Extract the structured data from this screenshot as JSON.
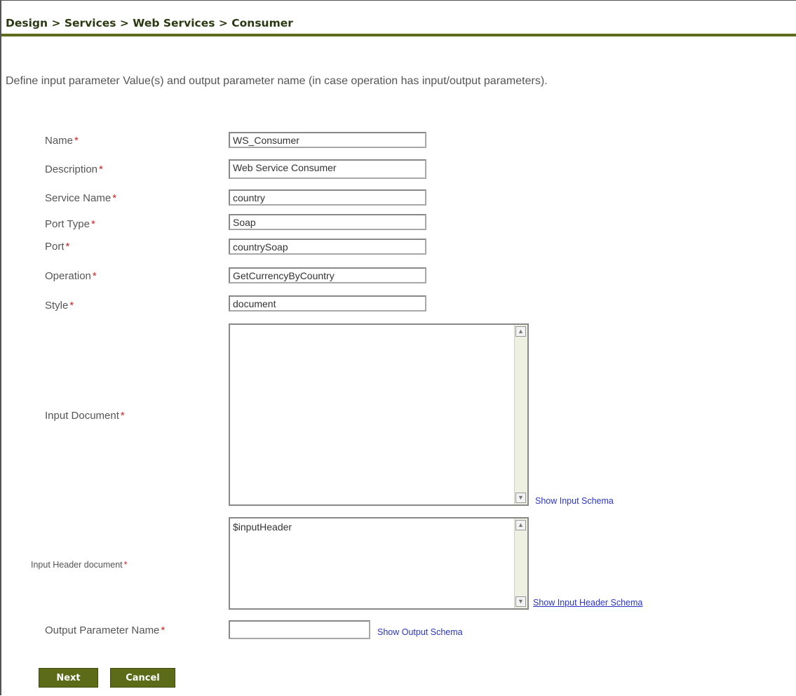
{
  "breadcrumb": "Design > Services > Web Services > Consumer",
  "intro": "Define input parameter Value(s) and output parameter name (in case operation has input/output parameters).",
  "required_marker": "*",
  "form": {
    "name": {
      "label": "Name",
      "value": "WS_Consumer"
    },
    "description": {
      "label": "Description",
      "value": "Web Service Consumer"
    },
    "service_name": {
      "label": "Service Name",
      "value": "country"
    },
    "port_type": {
      "label": "Port Type",
      "value": "Soap"
    },
    "port": {
      "label": "Port",
      "value": "countrySoap"
    },
    "operation": {
      "label": "Operation",
      "value": "GetCurrencyByCountry"
    },
    "style": {
      "label": "Style",
      "value": "document"
    },
    "input_document": {
      "label": "Input Document",
      "value": "",
      "link": "Show Input Schema"
    },
    "input_header": {
      "label": "Input Header document",
      "value": "$inputHeader",
      "link": "Show Input Header Schema"
    },
    "output_param": {
      "label": "Output Parameter Name",
      "value": "",
      "link": "Show Output Schema"
    }
  },
  "buttons": {
    "next": "Next",
    "cancel": "Cancel"
  },
  "colors": {
    "accent": "#5b6b17",
    "link": "#2a35c8",
    "required": "#cc2222"
  }
}
